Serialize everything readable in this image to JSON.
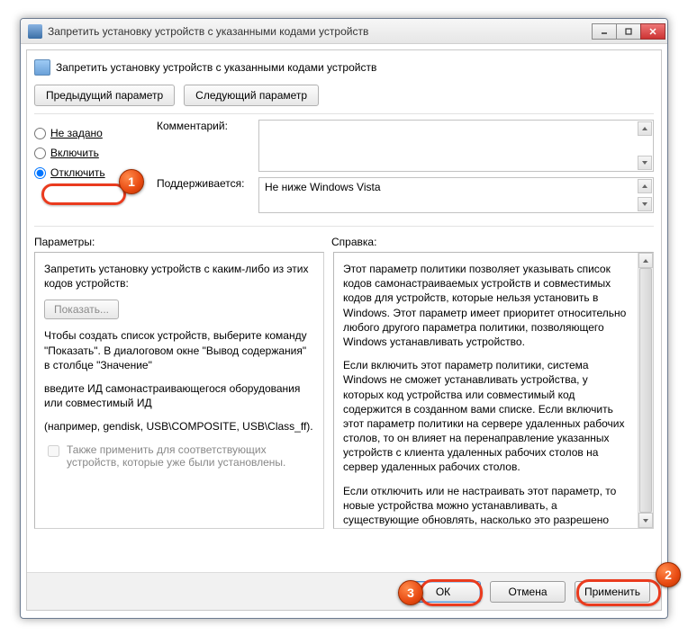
{
  "window": {
    "title": "Запретить установку устройств с указанными кодами устройств"
  },
  "header": {
    "title": "Запретить установку устройств с указанными кодами устройств"
  },
  "nav": {
    "prev": "Предыдущий параметр",
    "next": "Следующий параметр"
  },
  "radios": {
    "not_configured": "Не задано",
    "enabled": "Включить",
    "disabled": "Отключить"
  },
  "labels": {
    "comment": "Комментарий:",
    "supported": "Поддерживается:",
    "options": "Параметры:",
    "help": "Справка:"
  },
  "supported_text": "Не ниже Windows Vista",
  "options_panel": {
    "p1": "Запретить установку устройств с каким-либо из этих кодов устройств:",
    "show_btn": "Показать...",
    "p2": "Чтобы создать список устройств, выберите команду \"Показать\". В диалоговом окне \"Вывод содержания\" в столбце \"Значение\"",
    "p3": "введите ИД самонастраивающегося оборудования или совместимый ИД",
    "p4": "(например, gendisk, USB\\COMPOSITE, USB\\Class_ff).",
    "chk": "Также применить для соответствующих устройств, которые уже были установлены."
  },
  "help_panel": {
    "p1": "Этот параметр политики позволяет указывать список кодов самонастраиваемых устройств и совместимых кодов для устройств, которые нельзя установить в Windows. Этот параметр имеет приоритет относительно любого другого параметра политики, позволяющего Windows устанавливать устройство.",
    "p2": "Если включить этот параметр политики, система Windows не сможет устанавливать устройства, у которых код устройства или совместимый код содержится в созданном вами списке. Если включить этот параметр политики на сервере удаленных рабочих столов, то он влияет на перенаправление указанных устройств с клиента удаленных рабочих столов на сервер удаленных рабочих столов.",
    "p3": "Если отключить или не настраивать этот параметр, то новые устройства можно устанавливать, а существующие обновлять, насколько это разрешено или запрещено другими параметрами политики."
  },
  "buttons": {
    "ok": "ОК",
    "cancel": "Отмена",
    "apply": "Применить"
  },
  "annotations": {
    "b1": "1",
    "b2": "2",
    "b3": "3"
  }
}
